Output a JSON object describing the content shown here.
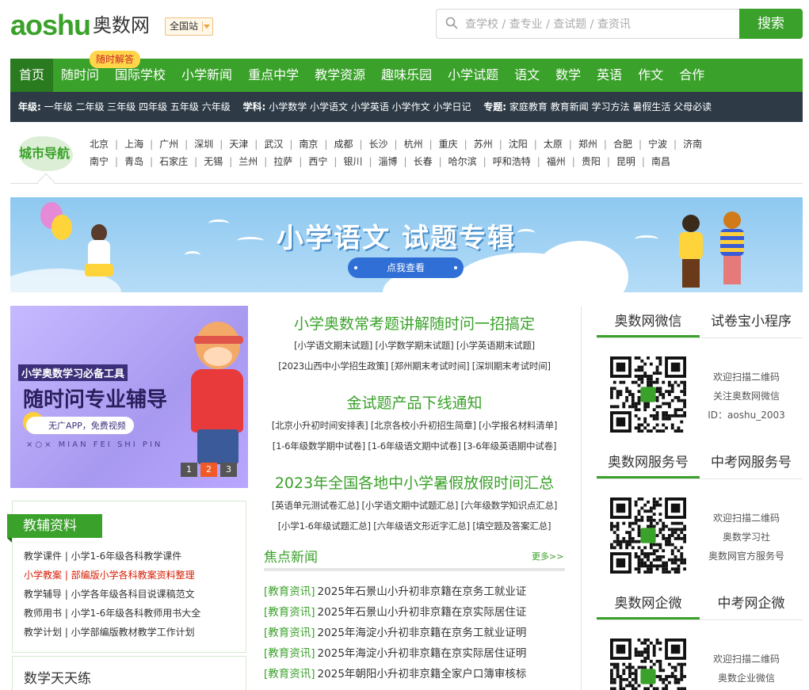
{
  "header": {
    "logo_en": "aoshu",
    "logo_cn": "奥数网",
    "site_select": "全国站",
    "search_placeholder": "查学校 / 查专业 / 查试题 / 查资讯",
    "search_button": "搜索"
  },
  "nav": {
    "badge": "随时解答",
    "items": [
      "首页",
      "随时问",
      "国际学校",
      "小学新闻",
      "重点中学",
      "教学资源",
      "趣味乐园",
      "小学试题",
      "语文",
      "数学",
      "英语",
      "作文",
      "合作"
    ]
  },
  "subnav": {
    "grade_label": "年级:",
    "grades": "一年级 二年级 三年级 四年级 五年级 六年级",
    "subject_label": "学科:",
    "subjects": "小学数学 小学语文 小学英语 小学作文 小学日记",
    "topic_label": "专题:",
    "topics": "家庭教育 教育新闻 学习方法 暑假生活 父母必读"
  },
  "city_nav": {
    "title": "城市导航",
    "row1": [
      "北京",
      "上海",
      "广州",
      "深圳",
      "天津",
      "武汉",
      "南京",
      "成都",
      "长沙",
      "杭州",
      "重庆",
      "苏州",
      "沈阳",
      "太原",
      "郑州",
      "合肥",
      "宁波",
      "济南"
    ],
    "row2": [
      "南宁",
      "青岛",
      "石家庄",
      "无锡",
      "兰州",
      "拉萨",
      "西宁",
      "银川",
      "淄博",
      "长春",
      "哈尔滨",
      "呼和浩特",
      "福州",
      "贵阳",
      "昆明",
      "南昌"
    ]
  },
  "banner": {
    "title": "小学语文  试题专辑",
    "button": "点我查看"
  },
  "carousel": {
    "line1": "小学奥数学习必备工具",
    "line2": "随时问专业辅导",
    "tag": "无广APP，免费视频",
    "pinyin": "×○× MIAN FEI SHI PIN",
    "dots": [
      "1",
      "2",
      "3"
    ],
    "active_dot": 2
  },
  "tutor": {
    "title": "教辅资料",
    "items": [
      "教学课件 | 小学1-6年级各科教学课件",
      "小学教案 | 部编版小学各科教案资料整理",
      "教学辅导 | 小学各年级各科目说课稿范文",
      "教师用书 | 小学1-6年级各科教师用书大全",
      "教学计划 | 小学部编版教材教学工作计划"
    ],
    "highlight_index": 1
  },
  "daily": {
    "title": "数学天天练"
  },
  "center": {
    "headline1": "小学奥数常考题讲解随时问一招搞定",
    "links1a": "[小学语文期末试题] [小学数学期末试题] [小学英语期末试题]",
    "links1b": "[2023山西中小学招生政策] [郑州期末考试时间] [深圳期末考试时间]",
    "headline2": "金试题产品下线通知",
    "links2a": "[北京小升初时间安排表] [北京各校小升初招生简章] [小学报名材料清单]",
    "links2b": "[1-6年级数学期中试卷] [1-6年级语文期中试卷] [3-6年级英语期中试卷]",
    "headline3": "2023年全国各地中小学暑假放假时间汇总",
    "links3a": "[英语单元测试卷汇总] [小学语文期中试题汇总] [六年级数学知识点汇总]",
    "links3b": "[小学1-6年级试题汇总] [六年级语文形近字汇总] [填空题及答案汇总]",
    "focus_title": "焦点新闻",
    "focus_more": "更多>>",
    "news": [
      {
        "cat": "[教育资讯]",
        "text": "2025年石景山小升初非京籍在京务工就业证"
      },
      {
        "cat": "[教育资讯]",
        "text": "2025年石景山小升初非京籍在京实际居住证"
      },
      {
        "cat": "[教育资讯]",
        "text": "2025年海淀小升初非京籍在京务工就业证明"
      },
      {
        "cat": "[教育资讯]",
        "text": "2025年海淀小升初非京籍在京实际居住证明"
      },
      {
        "cat": "[教育资讯]",
        "text": "2025年朝阳小升初非京籍全家户口簿审核标"
      }
    ]
  },
  "right": {
    "block1": {
      "tab1": "奥数网微信",
      "tab2": "试卷宝小程序",
      "lines": [
        "欢迎扫描二维码",
        "关注奥数网微信",
        "ID：aoshu_2003"
      ]
    },
    "block2": {
      "tab1": "奥数网服务号",
      "tab2": "中考网服务号",
      "lines": [
        "欢迎扫描二维码",
        "奥数学习社",
        "奥数网官方服务号"
      ]
    },
    "block3": {
      "tab1": "奥数网企微",
      "tab2": "中考网企微",
      "lines": [
        "欢迎扫描二维码",
        "奥数企业微信"
      ]
    },
    "qr_logo": "aoshu"
  },
  "colors": {
    "brand_green": "#3aa12a",
    "dark_bar": "#2e3b47",
    "highlight_red": "#d81e06",
    "badge_yellow": "#ffd54a"
  }
}
